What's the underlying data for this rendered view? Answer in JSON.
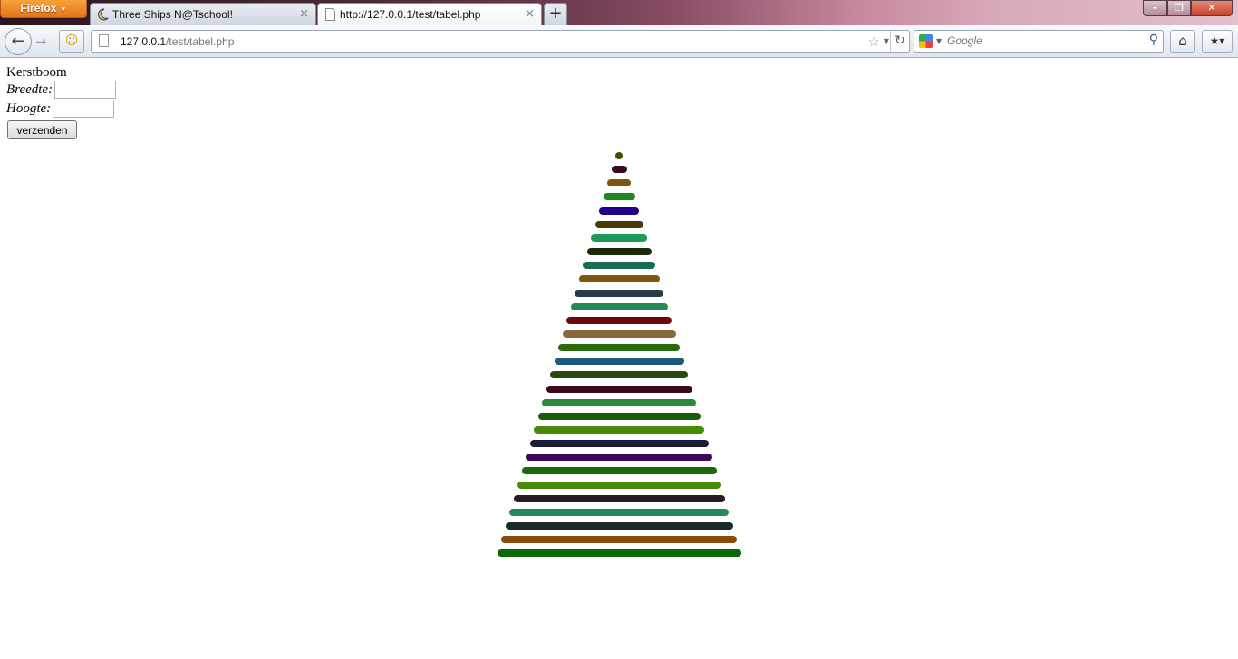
{
  "browser": {
    "app_menu_label": "Firefox",
    "tabs": [
      {
        "title": "Three Ships N@Tschool!",
        "icon": "moon-favicon-icon",
        "active": false
      },
      {
        "title": "http://127.0.0.1/test/tabel.php",
        "icon": "blank-page-icon",
        "active": true
      }
    ],
    "new_tab_symbol": "+",
    "url": {
      "host": "127.0.0.1",
      "path": "/test/tabel.php"
    },
    "search_placeholder": "Google",
    "icons": [
      "back-icon",
      "forward-icon",
      "sync-icon",
      "bookmark-star-icon",
      "reload-icon",
      "search-icon",
      "home-icon",
      "bookmarks-icon"
    ]
  },
  "page": {
    "heading": "Kerstboom",
    "breedte_label": "Breedte:",
    "hoogte_label": "Hoogte:",
    "breedte_value": "",
    "hoogte_value": "",
    "submit_label": "verzenden"
  },
  "tree": {
    "lines": [
      {
        "width": 1,
        "color": "#4a4a00"
      },
      {
        "width": 2,
        "color": "#3a0a24"
      },
      {
        "width": 3,
        "color": "#7a5a0a"
      },
      {
        "width": 4,
        "color": "#1e8a1e"
      },
      {
        "width": 5,
        "color": "#24008a"
      },
      {
        "width": 6,
        "color": "#4a3a0a"
      },
      {
        "width": 7,
        "color": "#1e9a5a"
      },
      {
        "width": 8,
        "color": "#1a2a0a"
      },
      {
        "width": 9,
        "color": "#1a6a5a"
      },
      {
        "width": 10,
        "color": "#7a5a0a"
      },
      {
        "width": 11,
        "color": "#2a3a4a"
      },
      {
        "width": 12,
        "color": "#248a5a"
      },
      {
        "width": 13,
        "color": "#6a0a0a"
      },
      {
        "width": 14,
        "color": "#8a6a3a"
      },
      {
        "width": 15,
        "color": "#2a6a0a"
      },
      {
        "width": 16,
        "color": "#1a5a7a"
      },
      {
        "width": 17,
        "color": "#2a4a0a"
      },
      {
        "width": 18,
        "color": "#3a0a1a"
      },
      {
        "width": 19,
        "color": "#2a8a3a"
      },
      {
        "width": 20,
        "color": "#1a5a0a"
      },
      {
        "width": 21,
        "color": "#4a8a0a"
      },
      {
        "width": 22,
        "color": "#1a1a3a"
      },
      {
        "width": 23,
        "color": "#3a0a5a"
      },
      {
        "width": 24,
        "color": "#1a6a0a"
      },
      {
        "width": 25,
        "color": "#4a8a0a"
      },
      {
        "width": 26,
        "color": "#2a1a2a"
      },
      {
        "width": 27,
        "color": "#248a5a"
      },
      {
        "width": 28,
        "color": "#1a2a2a"
      },
      {
        "width": 29,
        "color": "#8a4a0a"
      },
      {
        "width": 30,
        "color": "#0a6a0a"
      }
    ]
  }
}
